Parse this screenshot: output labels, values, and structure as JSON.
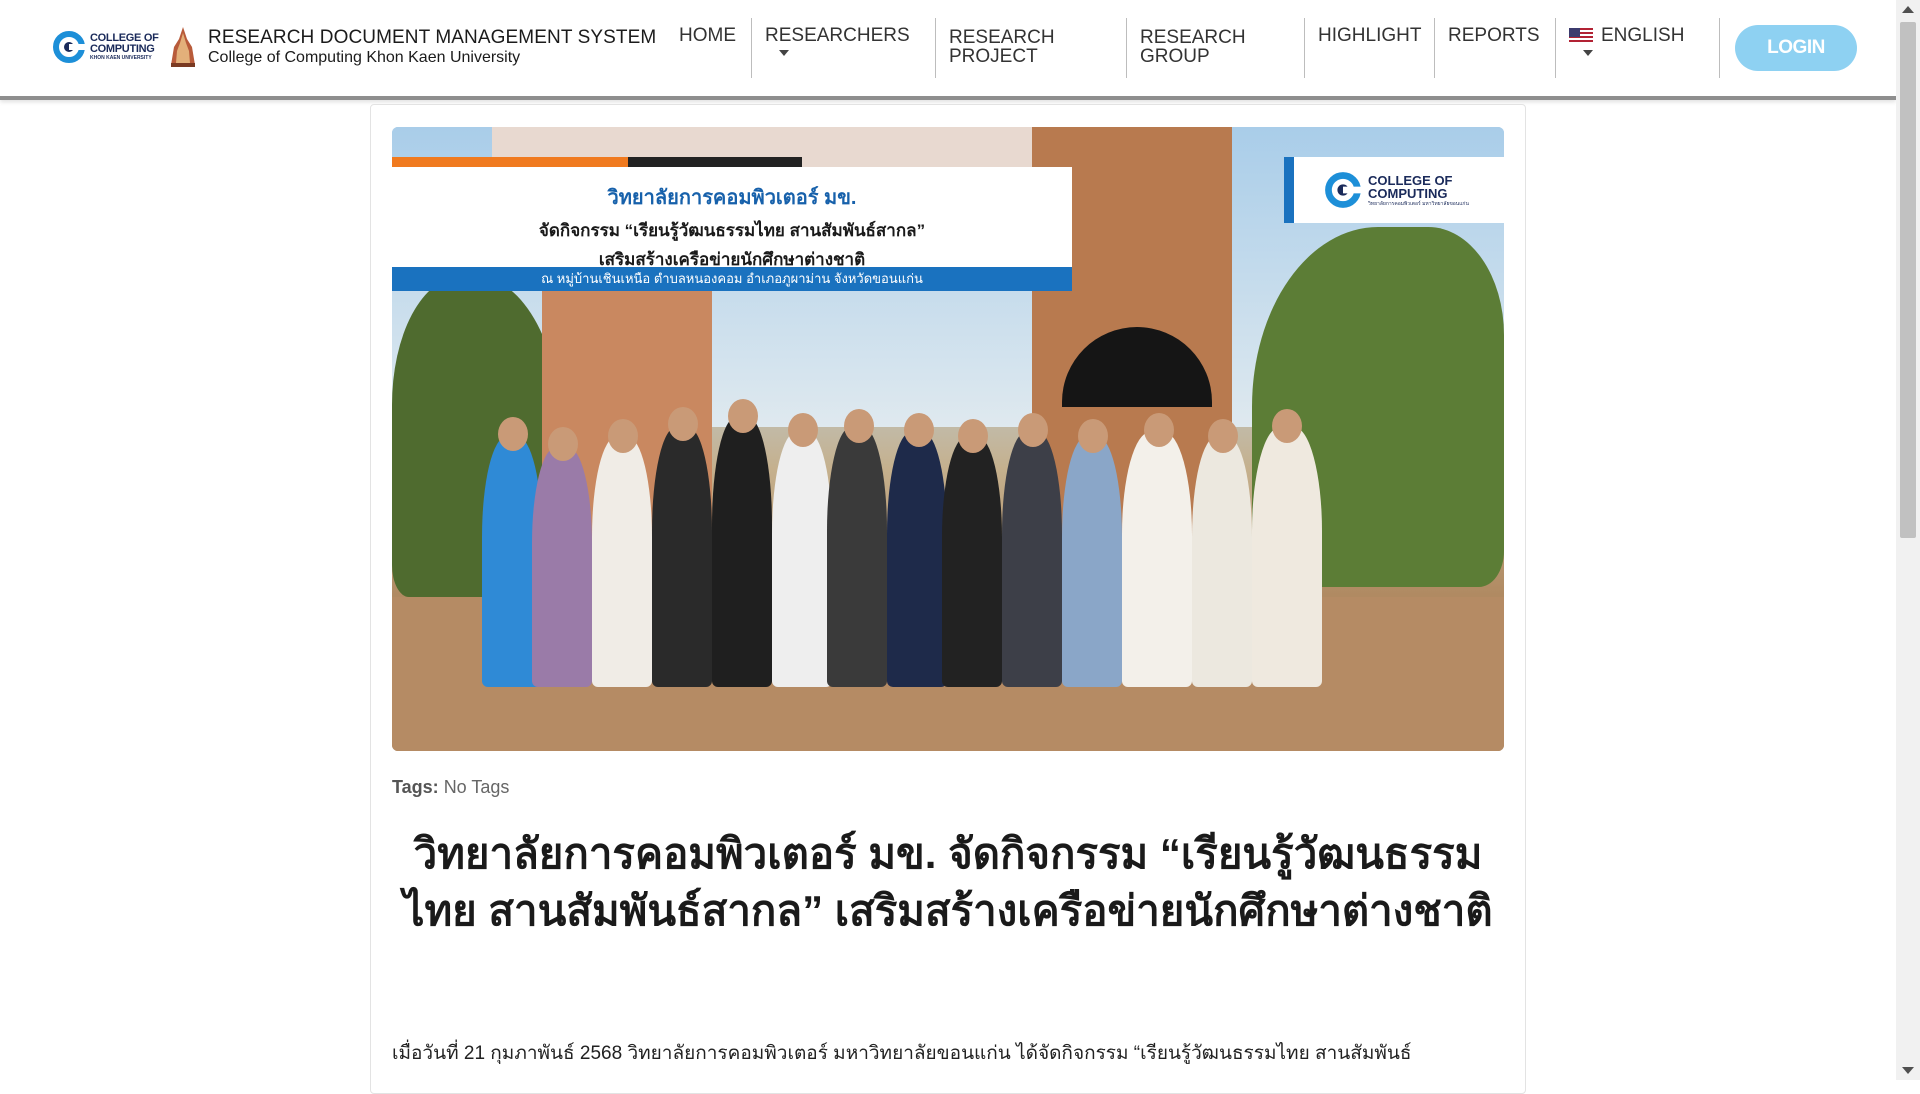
{
  "header": {
    "logo_line1": "COLLEGE OF",
    "logo_line2": "COMPUTING",
    "logo_line3": "KHON KAEN UNIVERSITY",
    "title": "RESEARCH DOCUMENT MANAGEMENT SYSTEM",
    "subtitle": "College of Computing Khon Kaen University"
  },
  "nav": {
    "items": [
      {
        "label": "HOME"
      },
      {
        "label": "RESEARCHERS"
      },
      {
        "label": "RESEARCH PROJECT"
      },
      {
        "label": "RESEARCH GROUP"
      },
      {
        "label": "HIGHLIGHT"
      },
      {
        "label": "REPORTS"
      },
      {
        "label": "ENGLISH"
      }
    ],
    "login_label": "LOGIN"
  },
  "article": {
    "image": {
      "banner_line1": "วิทยาลัยการคอมพิวเตอร์ มข.",
      "banner_line2": "จัดกิจกรรม “เรียนรู้วัฒนธรรมไทย สานสัมพันธ์สากล”",
      "banner_line3": "เสริมสร้างเครือข่ายนักศึกษาต่างชาติ",
      "banner_location": "ณ หมู่บ้านเชินเหนือ ตำบลหนองคอม อำเภอภูผาม่าน จังหวัดขอนแก่น",
      "logo_line1": "COLLEGE OF",
      "logo_line2": "COMPUTING",
      "logo_line3": "วิทยาลัยการคอมพิวเตอร์ มหาวิทยาลัยขอนแก่น"
    },
    "tags_label": "Tags:",
    "tags_value": "No Tags",
    "title": "วิทยาลัยการคอมพิวเตอร์ มข. จัดกิจกรรม “เรียนรู้วัฒนธรรมไทย สานสัมพันธ์สากล” เสริมสร้างเครือข่ายนักศึกษาต่างชาติ",
    "body": "เมื่อวันที่ 21 กุมภาพันธ์ 2568 วิทยาลัยการคอมพิวเตอร์ มหาวิทยาลัยขอนแก่น ได้จัดกิจกรรม “เรียนรู้วัฒนธรรมไทย สานสัมพันธ์"
  },
  "colors": {
    "login_bg": "#8ed1f2",
    "header_rule": "#8e8e8e",
    "banner_blue": "#1a72bf",
    "banner_orange": "#f07a1f"
  },
  "icons": {
    "brand": "college-of-computing-logo",
    "seal": "kku-seal-icon",
    "flag": "us-flag-icon",
    "caret": "caret-down-icon"
  }
}
